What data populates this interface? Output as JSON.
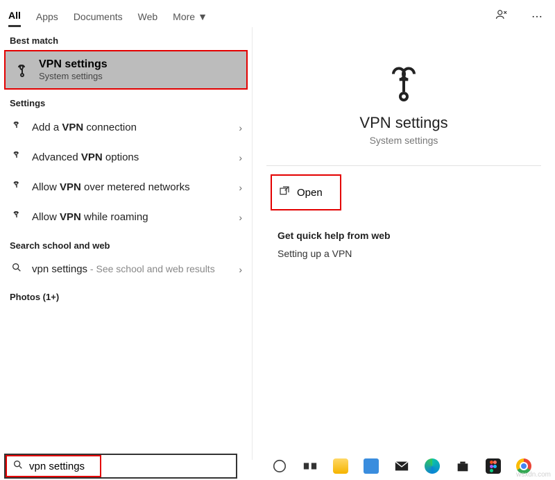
{
  "tabs": {
    "all": "All",
    "apps": "Apps",
    "documents": "Documents",
    "web": "Web",
    "more": "More"
  },
  "sections": {
    "best_match": "Best match",
    "settings": "Settings",
    "search_school_web": "Search school and web",
    "photos": "Photos (1+)"
  },
  "best_match_item": {
    "title": "VPN settings",
    "subtitle": "System settings"
  },
  "settings_items": [
    {
      "prefix": "Add a ",
      "bold": "VPN",
      "suffix": " connection"
    },
    {
      "prefix": "Advanced ",
      "bold": "VPN",
      "suffix": " options"
    },
    {
      "prefix": "Allow ",
      "bold": "VPN",
      "suffix": " over metered networks"
    },
    {
      "prefix": "Allow ",
      "bold": "VPN",
      "suffix": " while roaming"
    }
  ],
  "web_item": {
    "query": "vpn settings",
    "hint": " - See school and web results"
  },
  "preview": {
    "title": "VPN settings",
    "subtitle": "System settings",
    "open": "Open",
    "help_header": "Get quick help from web",
    "help_item": "Setting up a VPN"
  },
  "search": {
    "value": "vpn settings"
  },
  "watermark": "wsxdn.com"
}
